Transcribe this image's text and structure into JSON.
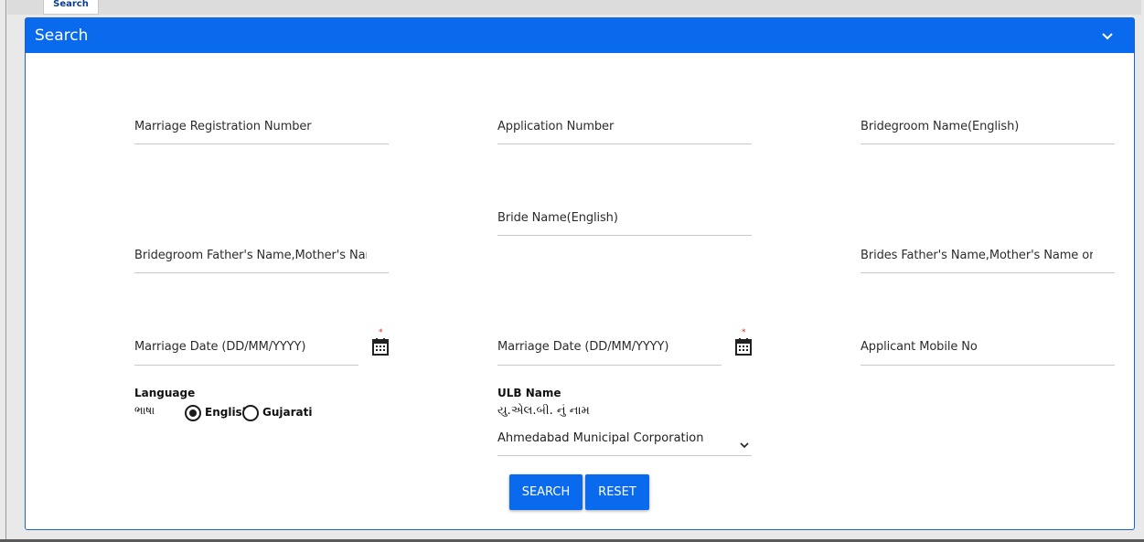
{
  "top_tab": {
    "label": "Search"
  },
  "panel": {
    "title": "Search"
  },
  "fields": {
    "marriage_registration_number": {
      "placeholder": "Marriage Registration Number"
    },
    "application_number": {
      "placeholder": "Application Number"
    },
    "bridegroom_name": {
      "placeholder": "Bridegroom Name(English)"
    },
    "bride_name": {
      "placeholder": "Bride Name(English)"
    },
    "bridegroom_father_name": {
      "placeholder": "Bridegroom Father's Name,Mother's Name c"
    },
    "brides_father_name": {
      "placeholder": "Brides Father's Name,Mother's Name or Gu"
    },
    "marriage_date_from": {
      "placeholder": "Marriage Date (DD/MM/YYYY)",
      "required_mark": "*"
    },
    "marriage_date_to": {
      "placeholder": "Marriage Date (DD/MM/YYYY)",
      "required_mark": "*"
    },
    "applicant_mobile": {
      "placeholder": "Applicant Mobile No"
    }
  },
  "language": {
    "title": "Language",
    "title_gujarati": "ભાષા",
    "options": [
      {
        "label": "English",
        "selected": true
      },
      {
        "label": "Gujarati",
        "selected": false
      }
    ]
  },
  "ulb": {
    "title": "ULB Name",
    "title_gujarati": "યુ.એલ.બી. નું નામ",
    "selected": "Ahmedabad Municipal Corporation"
  },
  "buttons": {
    "search": "SEARCH",
    "reset": "RESET"
  },
  "colors": {
    "header": "#0a6aee",
    "button": "#0a6aee",
    "required": "#d9261c"
  }
}
